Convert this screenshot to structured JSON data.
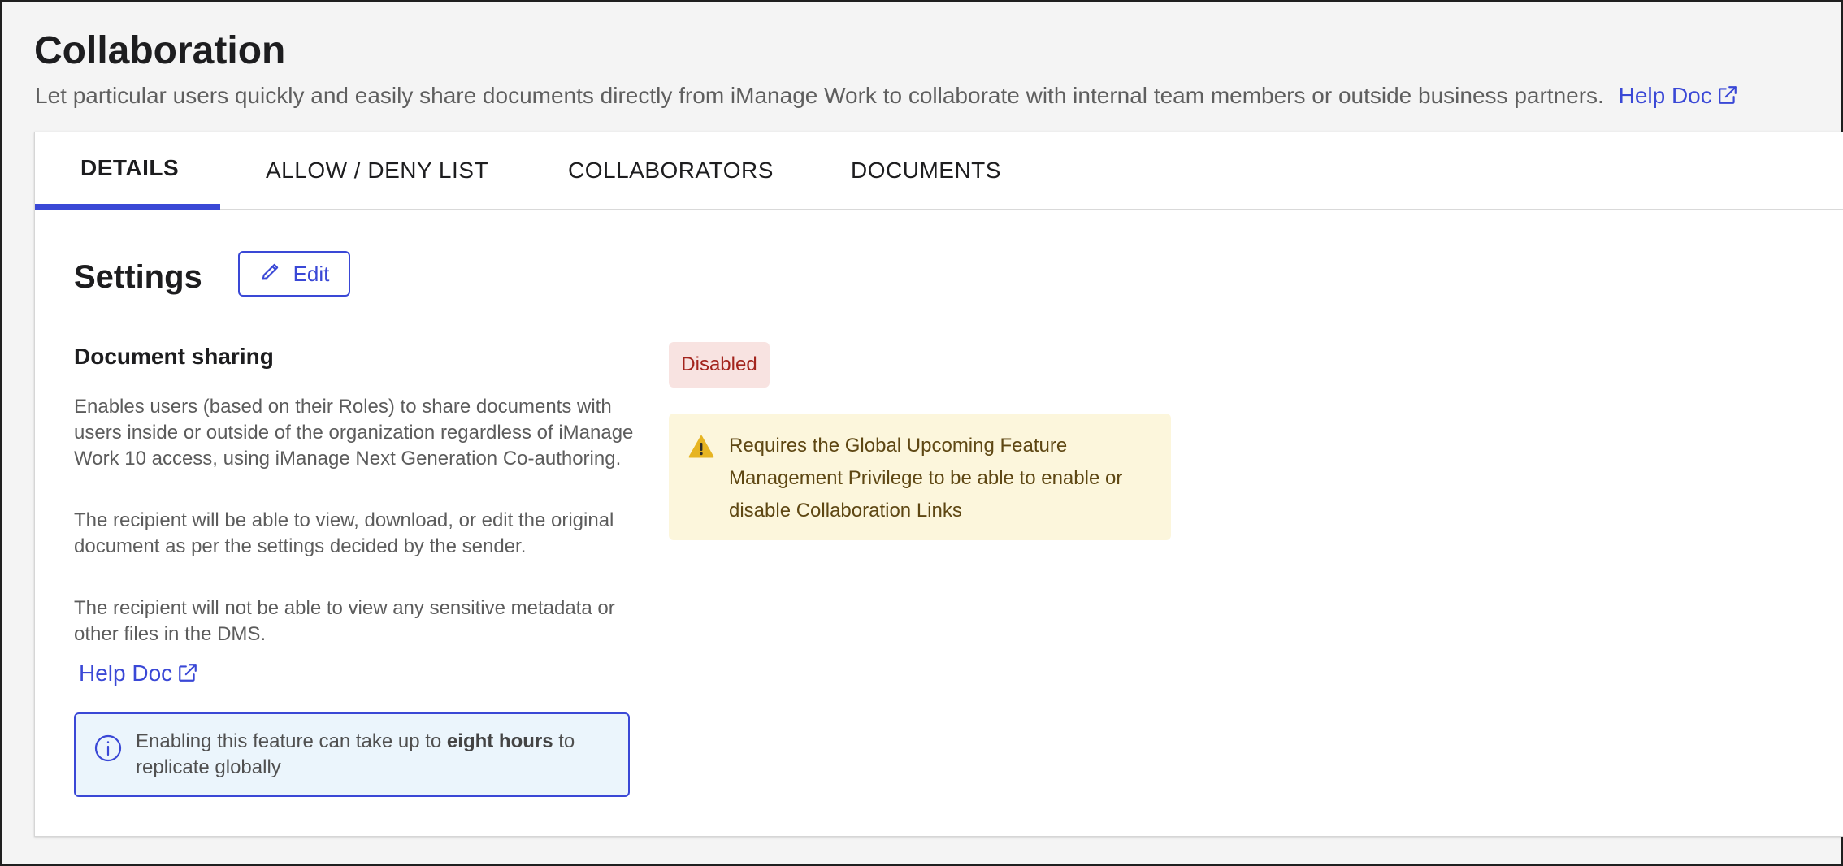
{
  "page": {
    "title": "Collaboration",
    "subtitle": "Let particular users quickly and easily share documents directly from iManage Work to collaborate with internal team members or outside business partners.",
    "help_link": "Help Doc"
  },
  "tabs": [
    {
      "label": "DETAILS",
      "active": true
    },
    {
      "label": "ALLOW / DENY LIST",
      "active": false
    },
    {
      "label": "COLLABORATORS",
      "active": false
    },
    {
      "label": "DOCUMENTS",
      "active": false
    }
  ],
  "settings": {
    "title": "Settings",
    "edit_label": "Edit"
  },
  "document_sharing": {
    "title": "Document sharing",
    "descriptions": [
      "Enables users (based on their Roles) to share documents with users inside or outside of the organization regardless of iManage Work 10 access, using iManage Next Generation Co-authoring.",
      "The recipient will be able to view, download, or edit the original document as per the settings decided by the sender.",
      "The recipient will not be able to view any sensitive metadata or other files in the DMS."
    ],
    "help_link": "Help Doc",
    "info": {
      "prefix": "Enabling this feature can take up to ",
      "bold": "eight hours",
      "suffix": " to replicate globally"
    },
    "status": "Disabled",
    "warning": "Requires the Global Upcoming Feature Management Privilege to be able to enable or disable Collaboration Links"
  },
  "colors": {
    "accent": "#3a48d6",
    "disabled_bg": "#f8e3e1",
    "disabled_text": "#a3241d",
    "warning_bg": "#fcf6dc",
    "warning_icon": "#e6b422",
    "info_bg": "#ebf5fc"
  },
  "icons": {
    "help": "external-link-icon",
    "edit": "pencil-icon",
    "info": "info-circle-icon",
    "warning": "warning-triangle-icon"
  }
}
